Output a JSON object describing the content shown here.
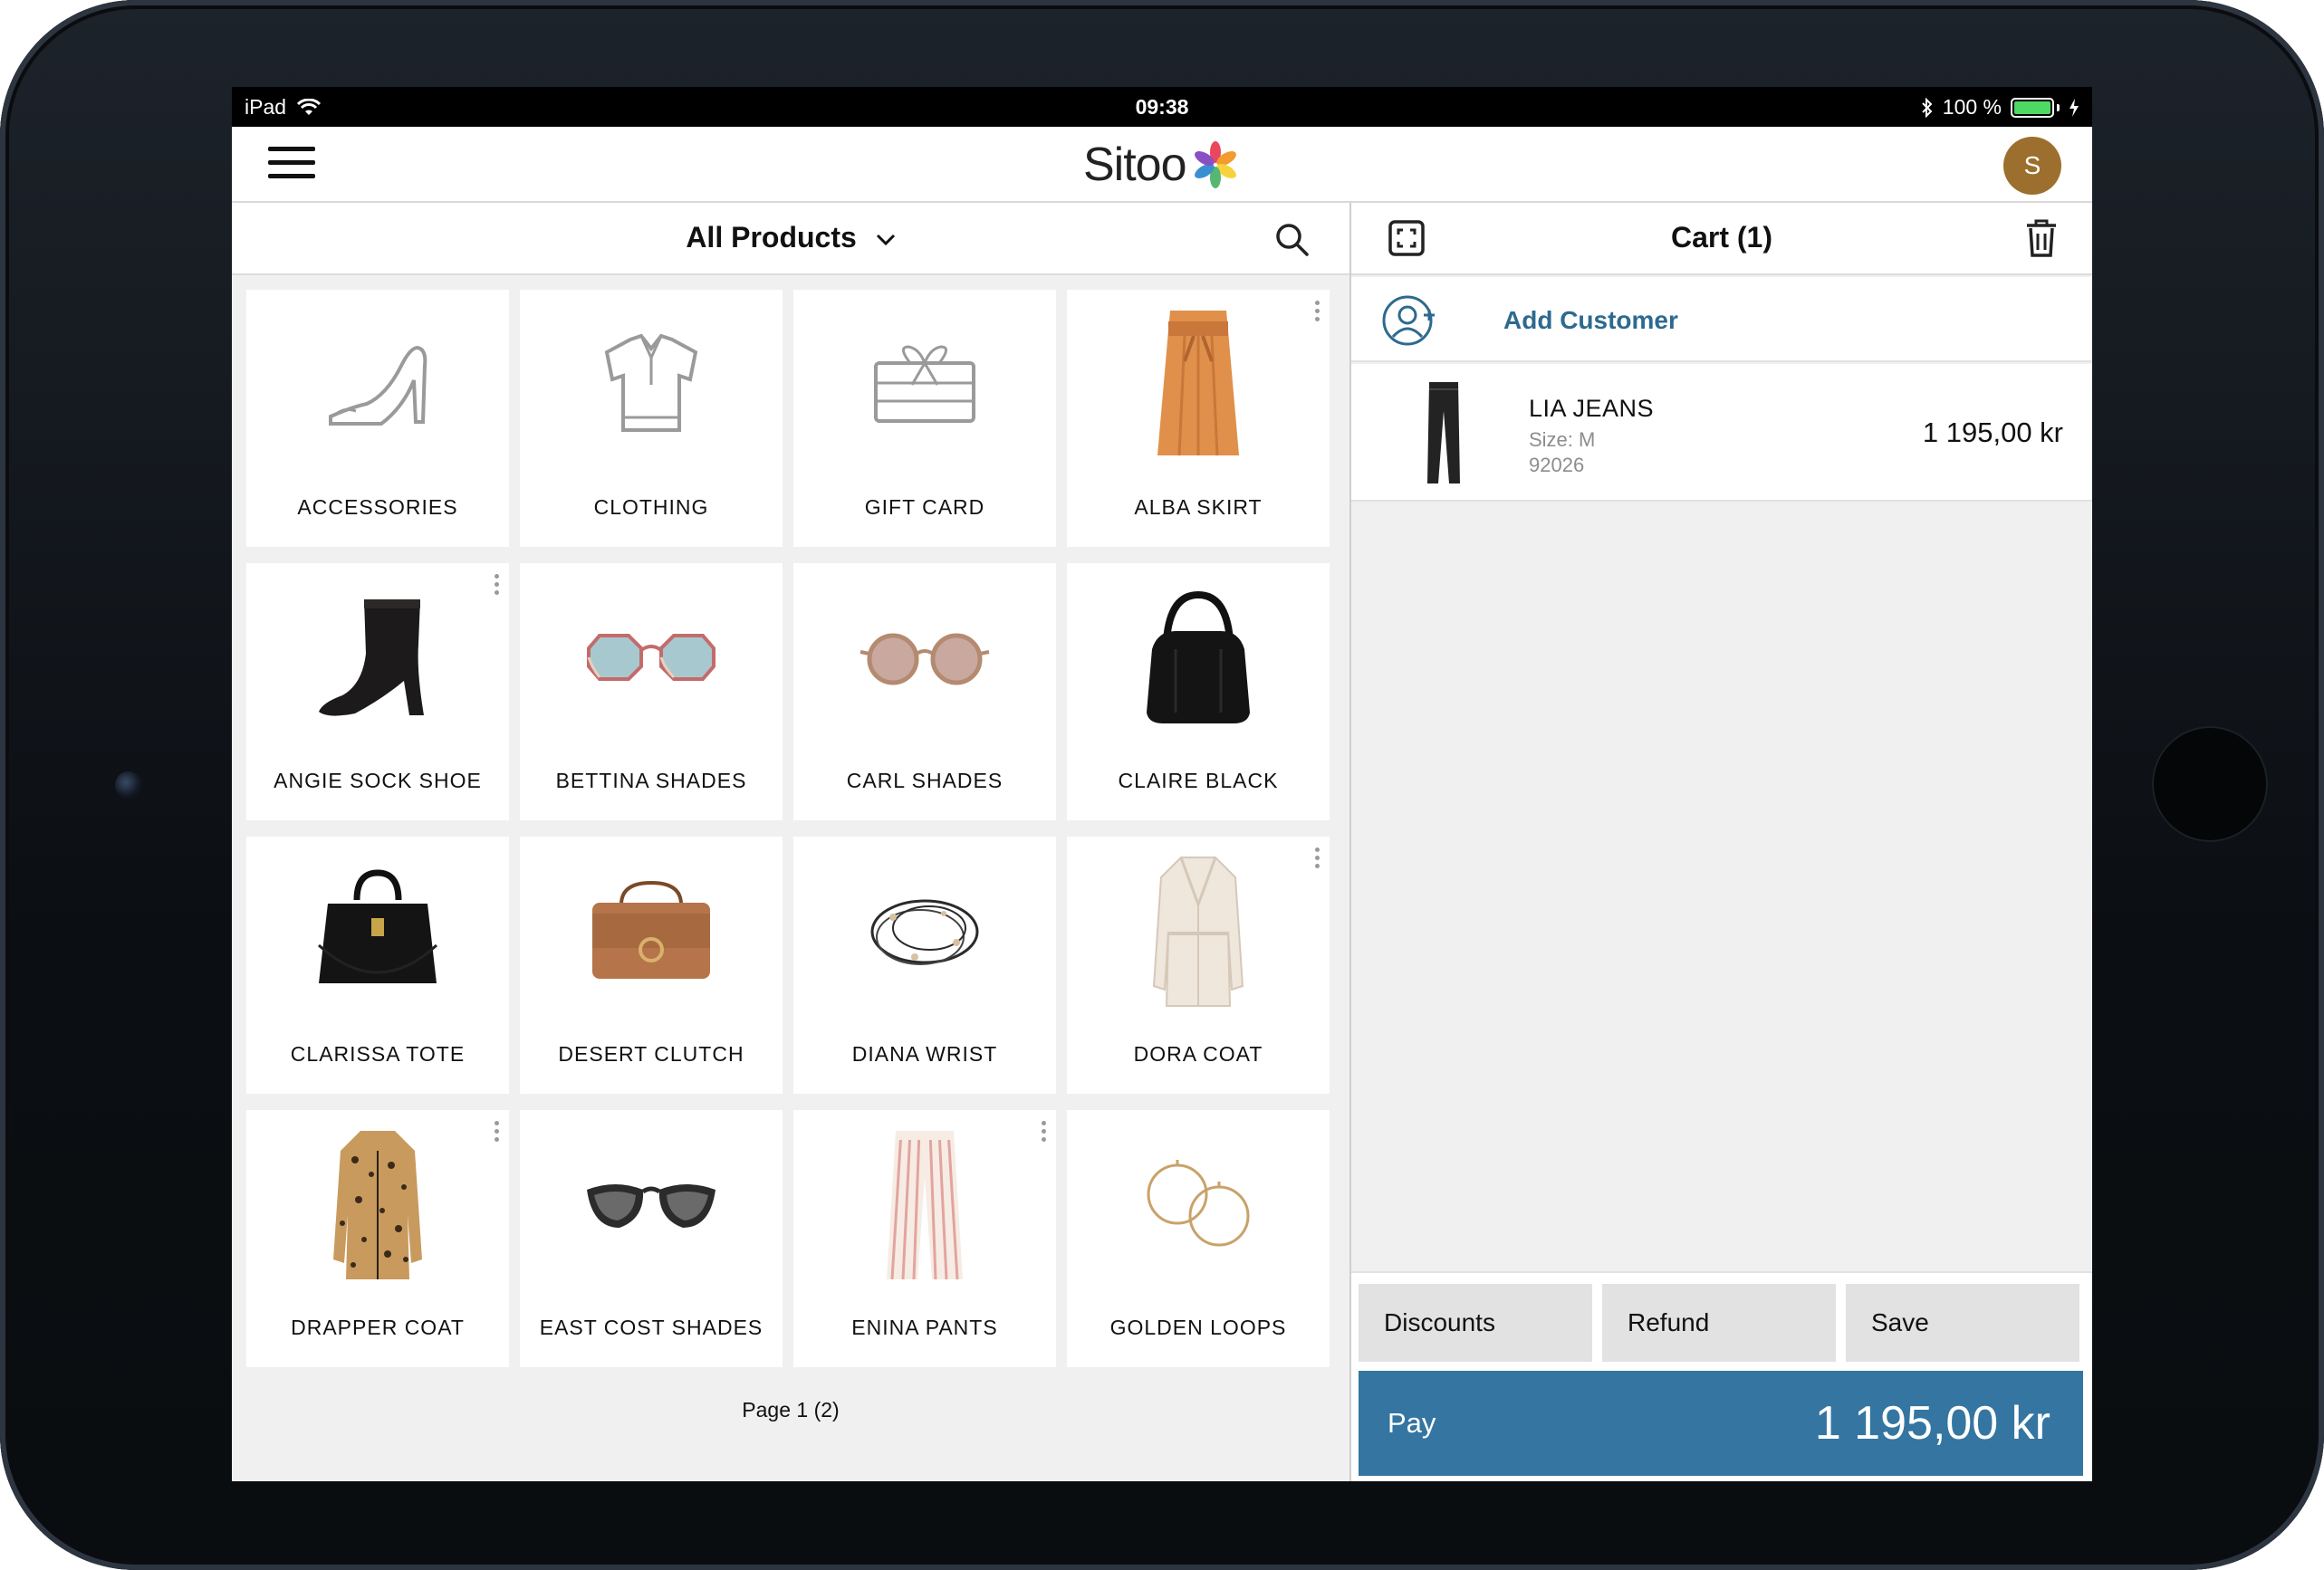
{
  "status_bar": {
    "device": "iPad",
    "time": "09:38",
    "battery": "100 %"
  },
  "header": {
    "logo": "Sitoo",
    "avatar_initial": "S"
  },
  "products": {
    "category": "All Products",
    "tiles": [
      {
        "label": "ACCESSORIES",
        "icon": "shoe-outline-icon"
      },
      {
        "label": "CLOTHING",
        "icon": "shirt-outline-icon"
      },
      {
        "label": "GIFT CARD",
        "icon": "gift-card-outline-icon"
      },
      {
        "label": "ALBA SKIRT",
        "icon": "skirt-icon"
      },
      {
        "label": "ANGIE SOCK SHOE",
        "icon": "boot-icon"
      },
      {
        "label": "BETTINA SHADES",
        "icon": "octagon-sunglasses-icon"
      },
      {
        "label": "CARL SHADES",
        "icon": "round-sunglasses-icon"
      },
      {
        "label": "CLAIRE BLACK",
        "icon": "hobo-bag-icon"
      },
      {
        "label": "CLARISSA TOTE",
        "icon": "tote-bag-icon"
      },
      {
        "label": "DESERT CLUTCH",
        "icon": "clutch-bag-icon"
      },
      {
        "label": "DIANA WRIST",
        "icon": "bracelet-icon"
      },
      {
        "label": "DORA COAT",
        "icon": "trench-coat-icon"
      },
      {
        "label": "DRAPPER COAT",
        "icon": "leopard-coat-icon"
      },
      {
        "label": "EAST COST SHADES",
        "icon": "cat-eye-sunglasses-icon"
      },
      {
        "label": "ENINA PANTS",
        "icon": "striped-pants-icon"
      },
      {
        "label": "GOLDEN LOOPS",
        "icon": "hoop-earrings-icon"
      }
    ],
    "pager": "Page 1 (2)"
  },
  "cart": {
    "title": "Cart (1)",
    "add_customer": "Add Customer",
    "items": [
      {
        "name": "LIA JEANS",
        "size": "Size: M",
        "sku": "92026",
        "price": "1 195,00 kr"
      }
    ],
    "actions": {
      "discounts": "Discounts",
      "refund": "Refund",
      "save": "Save"
    },
    "pay": {
      "label": "Pay",
      "total": "1 195,00 kr"
    }
  },
  "colors": {
    "pay_button": "#3476a1",
    "link_blue": "#2d6a8f",
    "avatar": "#9c6f2e",
    "battery": "#4cd964"
  }
}
